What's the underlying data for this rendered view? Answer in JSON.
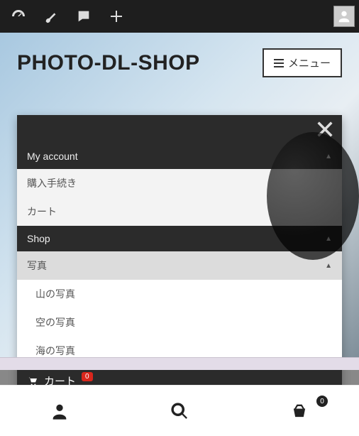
{
  "site": {
    "title": "PHOTO-DL-SHOP"
  },
  "header": {
    "menu_label": "メニュー"
  },
  "nav": {
    "my_account": "My account",
    "checkout": "購入手続き",
    "cart_page": "カート",
    "shop": "Shop",
    "photos": "写真",
    "photo_mountain": "山の写真",
    "photo_sky": "空の写真",
    "photo_sea": "海の写真",
    "cart_label": "カート",
    "cart_badge": "0"
  },
  "tabbar": {
    "cart_count": "0"
  }
}
